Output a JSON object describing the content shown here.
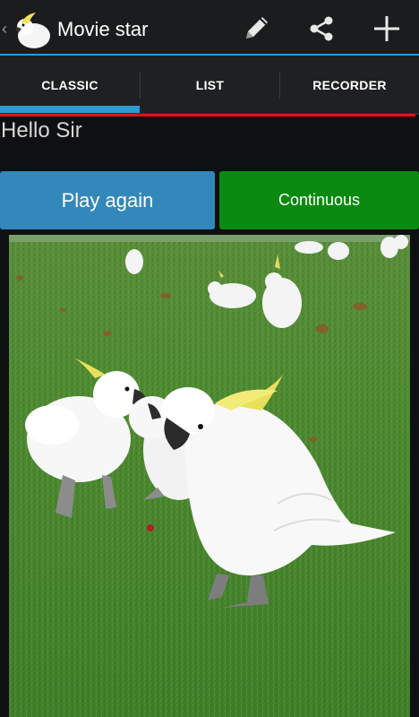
{
  "actionbar": {
    "title": "Movie star",
    "actions": [
      "pencil-icon",
      "share-icon",
      "plus-icon"
    ]
  },
  "tabs": [
    {
      "label": "CLASSIC",
      "selected": true
    },
    {
      "label": "LIST",
      "selected": false
    },
    {
      "label": "RECORDER",
      "selected": false
    }
  ],
  "main": {
    "greeting": "Hello Sir",
    "play_again_label": "Play again",
    "continuous_label": "Continuous"
  },
  "colors": {
    "accent": "#2b9bd0",
    "play_button": "#3388bb",
    "continuous_button": "#0a8a10",
    "highlight_line": "#e31212"
  }
}
